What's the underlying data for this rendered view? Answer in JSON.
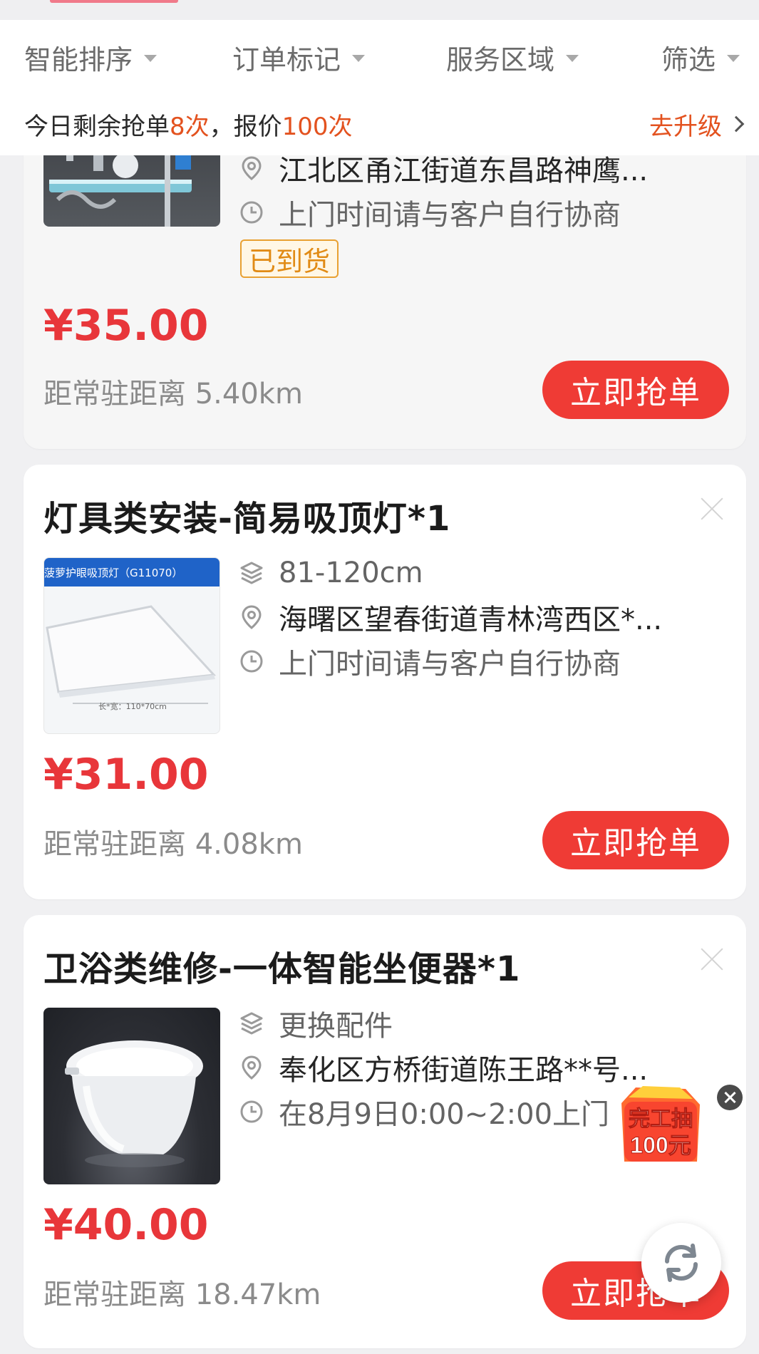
{
  "filters": [
    "智能排序",
    "订单标记",
    "服务区域",
    "筛选"
  ],
  "quota": {
    "prefix": "今日剩余抢单",
    "grab_count": "8次",
    "separator": "，报价",
    "quote_count": "100次"
  },
  "upgrade_label": "去升级",
  "orders": [
    {
      "address": "江北区甬江街道东昌路神鹰...",
      "visit_time": "上门时间请与客户自行协商",
      "status_badge": "已到货",
      "price": "¥35.00",
      "distance": "距常驻距离 5.40km",
      "grab_label": "立即抢单"
    },
    {
      "title": "灯具类安装-简易吸顶灯*1",
      "spec": "81-120cm",
      "address": "海曙区望春街道青林湾西区*...",
      "visit_time": "上门时间请与客户自行协商",
      "price": "¥31.00",
      "distance": "距常驻距离 4.08km",
      "grab_label": "立即抢单",
      "product_label": "菠萝护眼吸顶灯（G11070）",
      "product_size": "长*宽：110*70cm"
    },
    {
      "title": "卫浴类维修-一体智能坐便器*1",
      "spec": "更换配件",
      "address": "奉化区方桥街道陈王路**号...",
      "visit_time": "在8月9日0:00~2:00上门",
      "price": "¥40.00",
      "distance": "距常驻距离 18.47km",
      "grab_label": "立即抢单"
    }
  ],
  "promo": {
    "line1": "完工抽",
    "line2": "100元"
  },
  "colors": {
    "accent_red": "#ef3b35",
    "price_red": "#e8363a",
    "highlight_orange": "#e3521f",
    "badge_orange": "#e18b15"
  }
}
